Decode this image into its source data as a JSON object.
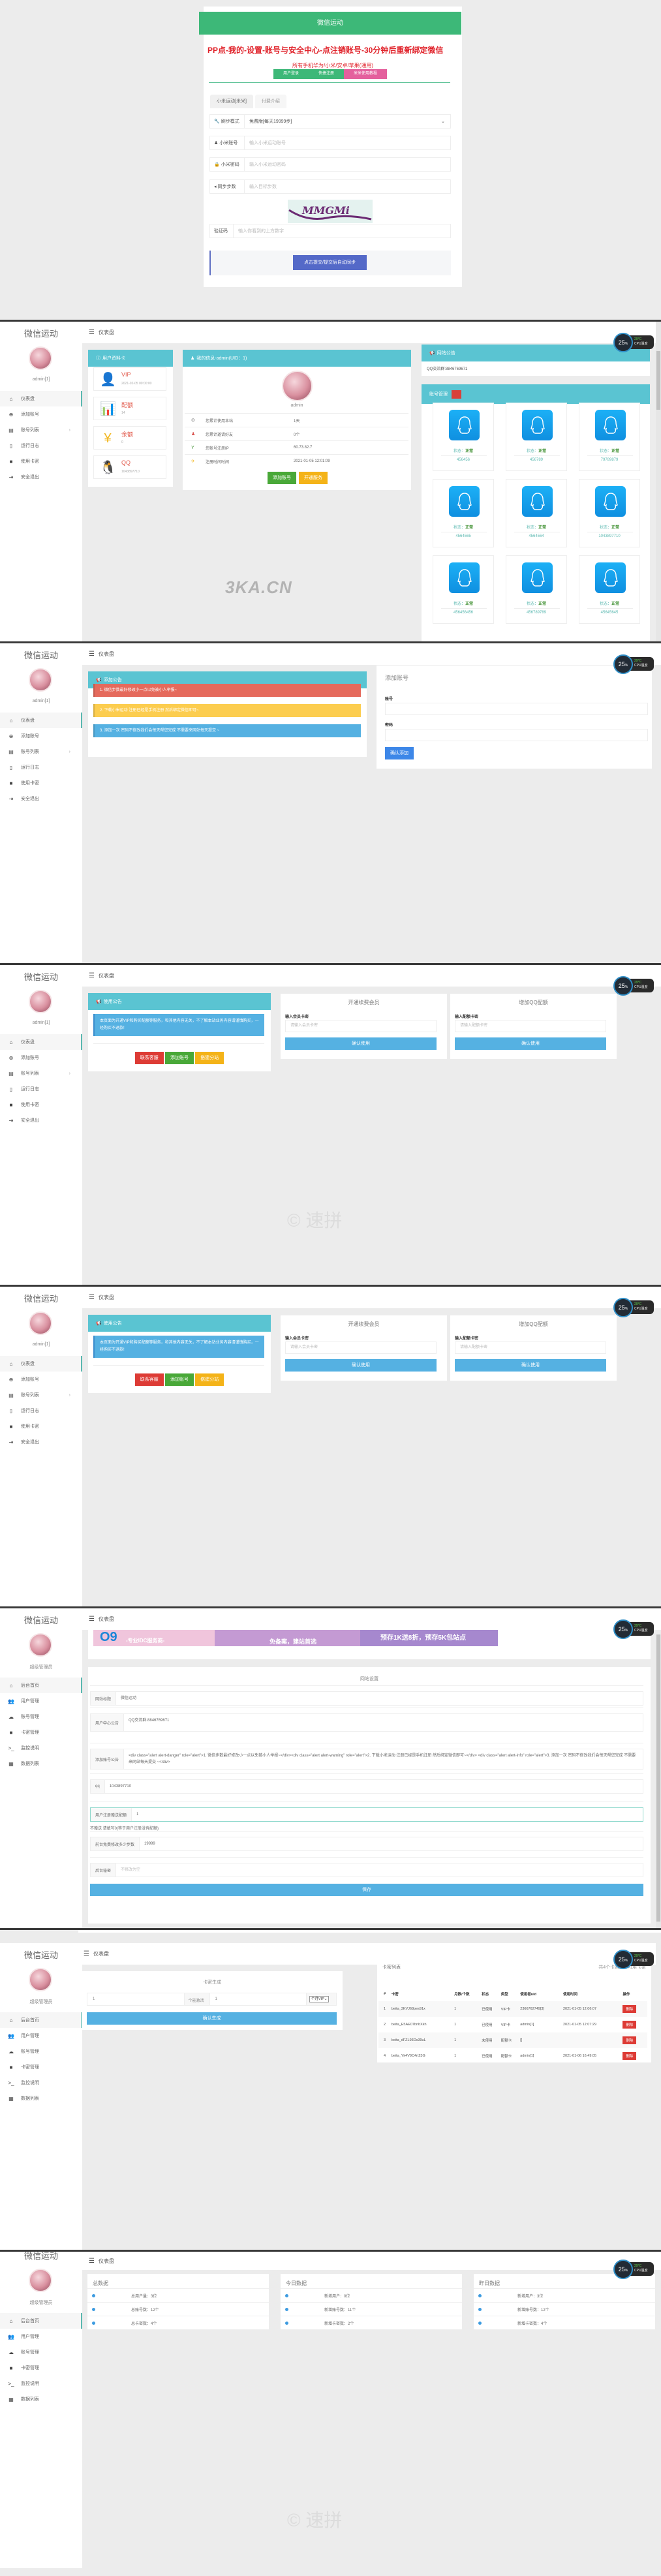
{
  "login": {
    "header": "微信运动",
    "notice": "PP点-我的-设置-账号与安全中心-点注销账号-30分钟后重新绑定微信",
    "subnotice": "所有手机华为/小米/安卓/苹果(通用)",
    "top_tabs": [
      "用户登录",
      "快捷注册",
      "米米使用教程"
    ],
    "sub_tabs": [
      "小米运动[米米]",
      "付费介绍"
    ],
    "mode_label": "刷步模式",
    "mode_value": "免费版[每天19999步]",
    "account_label": "小米账号",
    "account_placeholder": "输入小米运动账号",
    "password_label": "小米密码",
    "password_placeholder": "输入小米运动密码",
    "steps_label": "同步步数",
    "steps_placeholder": "输入目标步数",
    "captcha_text": "MMGMi",
    "captcha_label": "验证码",
    "captcha_placeholder": "输入你看到的上方数字",
    "submit": "点击提交/提交后自动同步"
  },
  "user_sidebar": {
    "title": "微信运动",
    "username": "admin[1]",
    "items": [
      {
        "icon": "home-icon",
        "glyph": "⌂",
        "label": "仪表盘"
      },
      {
        "icon": "add-circle-icon",
        "glyph": "⊕",
        "label": "添加账号"
      },
      {
        "icon": "list-icon",
        "glyph": "▤",
        "label": "账号列表",
        "arrow": "›"
      },
      {
        "icon": "file-icon",
        "glyph": "▯",
        "label": "运行日志"
      },
      {
        "icon": "tag-icon",
        "glyph": "■",
        "label": "使用卡密"
      },
      {
        "icon": "logout-icon",
        "glyph": "⇥",
        "label": "安全退出"
      }
    ]
  },
  "admin_sidebar": {
    "title": "微信运动",
    "username": "超级管理员",
    "items": [
      {
        "icon": "home-icon",
        "glyph": "⌂",
        "label": "后台首页"
      },
      {
        "icon": "users-icon",
        "glyph": "👥",
        "label": "用户管理"
      },
      {
        "icon": "cloud-icon",
        "glyph": "☁",
        "label": "账号管理"
      },
      {
        "icon": "tag-icon",
        "glyph": "■",
        "label": "卡密管理"
      },
      {
        "icon": "terminal-icon",
        "glyph": ">_",
        "label": "监控说明"
      },
      {
        "icon": "database-icon",
        "glyph": "▦",
        "label": "数据列表"
      }
    ]
  },
  "topbar": {
    "title": "仪表盘"
  },
  "cpu_widget": {
    "percent": "25",
    "unit": "%",
    "temp": "29°C",
    "label": "CPU温度"
  },
  "dashboard": {
    "profile_card_title": "用户资料卡",
    "profile_items": [
      {
        "icon": "user-icon",
        "title": "VIP",
        "sub": "2021-02-05 00:00:00",
        "color": "#4a9fe0"
      },
      {
        "icon": "bar-chart-icon",
        "title": "配额",
        "sub": "14",
        "color": "#3f6fc9"
      },
      {
        "icon": "yuan-icon",
        "title": "余额",
        "sub": "0",
        "color": "#f2b51a"
      },
      {
        "icon": "qq-icon",
        "title": "QQ",
        "sub": "1043897710",
        "color": "#4ea64a"
      }
    ],
    "my_info_title": "我的信息-admin(UID：1)",
    "my_name": "admin",
    "my_info_rows": [
      {
        "icon": "clock-icon",
        "glyph": "⊙",
        "color": "#555",
        "key": "您累计使用本站",
        "value": "1天"
      },
      {
        "icon": "user-icon",
        "glyph": "♟",
        "color": "#d9534f",
        "key": "您累计邀请好友",
        "value": "0个"
      },
      {
        "icon": "glass-icon",
        "glyph": "Y",
        "color": "#3d8f2f",
        "key": "您帐号注册IP",
        "value": "60.73.82.7"
      },
      {
        "icon": "plane-icon",
        "glyph": "✈",
        "color": "#f2b51a",
        "key": "注册时间时间",
        "value": "2021-01-05 12:01:09"
      }
    ],
    "add_account_btn": "添加账号",
    "open_service_btn": "开通服务",
    "site_notice_title": "网站公告",
    "site_notice_text": "QQ交流群:8846769671",
    "account_mgmt_title": "账号管理",
    "account_status_label": "状态：",
    "account_status_value": "正常",
    "accounts": [
      "456456",
      "456789",
      "79789879",
      "4564565",
      "4564564",
      "1043897710",
      "456456456",
      "456789789",
      "45645645"
    ],
    "watermark": "3KA.CN"
  },
  "add_account": {
    "notice_title": "添加公告",
    "alerts": [
      {
        "text": "1. 微信步数最好修改小一点以免被小人举报~",
        "color": "#e56a5c"
      },
      {
        "text": "2. 下载小米运动 注册已经是手机注册 然后绑定微信即可~",
        "color": "#fccd4f"
      },
      {
        "text": "3. 添加一次 密码不修改我们会每天帮您完成 不需要来网站每天提交 ~",
        "color": "#55b1e2"
      }
    ],
    "form_title": "添加账号",
    "account_label": "账号",
    "password_label": "密码",
    "submit": "确认添加"
  },
  "cardkey": {
    "notice_title": "使用公告",
    "notice_text": "本页面为开通VIP和购买配额等服务，和其他内容无关，不了解本站业务内容请谨慎购买，一经购买不退款!",
    "buttons": [
      "联系客服",
      "添加账号",
      "搭建分站"
    ],
    "vip_title": "开通续费会员",
    "vip_label": "输入会员卡密",
    "vip_placeholder": "请输入会员卡密",
    "quota_title": "增加QQ配额",
    "quota_label": "输入配额卡密",
    "quota_placeholder": "请输入配额卡密",
    "confirm": "确认使用",
    "watermark": "© 速拼"
  },
  "settings": {
    "banner_left": "-专业IDC服务商-",
    "banner_mid": "免备案，建站首选",
    "banner_right": "预存1K送8折，预存5K包站点",
    "title": "网站设置",
    "fields": [
      {
        "label": "网站标题",
        "value": "微信运动"
      },
      {
        "label": "用户中心公告",
        "value": "QQ交流群:8846769671"
      },
      {
        "label": "添加账号公告",
        "value": "<div class=\"alert alert-danger\" role=\"alert\">1. 微信步数最好修改小一点以免被小人举报~</div><div class=\"alert alert-warning\" role=\"alert\">2. 下载小米运动 注册已经是手机注册 然后绑定微信即可~</div> <div class=\"alert alert-info\" role=\"alert\">3. 添加一次 密码不修改我们会每天帮您完成 不需要来网站每天提交 ~</div>"
      },
      {
        "label": "qq",
        "value": "1043897710"
      },
      {
        "label": "用户注册赠送配额",
        "value": "1"
      },
      {
        "label": "前台免费修改多少步数",
        "value": "19999"
      },
      {
        "label": "后台秘密",
        "placeholder": "不修改为空"
      }
    ],
    "hint": "不赠送 请填写0(等于用户注册没有配额)",
    "save": "保存"
  },
  "card_gen": {
    "title": "卡密生成",
    "count": "1",
    "mid_label": "个能激活",
    "months": "1",
    "type": "个月VIP",
    "submit": "确认生成"
  },
  "card_list": {
    "title": "卡密列表",
    "summary": "共4个卡密,1个可用卡密",
    "columns": [
      "#",
      "卡密",
      "月数/个数",
      "状态",
      "类型",
      "使用者uid",
      "使用时间",
      "操作"
    ],
    "rows": [
      [
        "1",
        "beita_3KVJ68pes91x",
        "1",
        "已使用",
        "VIP卡",
        "2366762749[3]",
        "2021-01-05 12:06:07"
      ],
      [
        "2",
        "beita_E5AE07bnbXkh",
        "1",
        "已使用",
        "VIP卡",
        "admin[1]",
        "2021-01-05 12:07:29"
      ],
      [
        "3",
        "beita_dFZL93Ds39uL",
        "1",
        "未使用",
        "配额卡",
        "[]",
        ""
      ],
      [
        "4",
        "beita_Yk4V9C4rt23G",
        "1",
        "已使用",
        "配额卡",
        "admin[1]",
        "2021-01-06 16:49:05"
      ]
    ],
    "delete": "删除"
  },
  "stats": [
    {
      "title": "总数据",
      "rows": [
        "总用户量：3位",
        "总账号数：12个",
        "总卡密数：4个"
      ]
    },
    {
      "title": "今日数据",
      "rows": [
        "新增用户：0位",
        "新增账号数：11个",
        "新增卡密数：2个"
      ]
    },
    {
      "title": "昨日数据",
      "rows": [
        "新增用户：3位",
        "新增账号数：12个",
        "新增卡密数：4个"
      ]
    }
  ]
}
